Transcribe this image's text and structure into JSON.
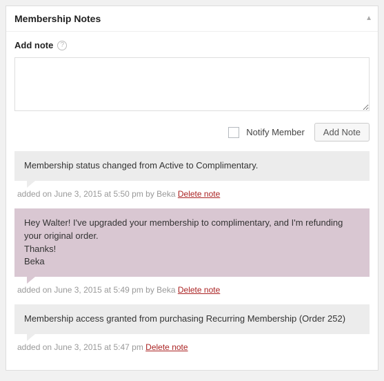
{
  "panel": {
    "title": "Membership Notes"
  },
  "add_note": {
    "label": "Add note",
    "textarea_value": "",
    "notify_label": "Notify Member",
    "notify_checked": false,
    "button_label": "Add Note"
  },
  "notes": [
    {
      "type": "system",
      "content": "Membership status changed from Active to Complimentary.",
      "meta_prefix": "added on ",
      "date": "June 3, 2015 at 5:50 pm",
      "by_word": " by ",
      "author": "Beka",
      "delete_label": "Delete note"
    },
    {
      "type": "customer",
      "content": "Hey Walter! I've upgraded your membership to complimentary, and I'm refunding your original order.\nThanks!\nBeka",
      "meta_prefix": "added on ",
      "date": "June 3, 2015 at 5:49 pm",
      "by_word": " by ",
      "author": "Beka",
      "delete_label": "Delete note"
    },
    {
      "type": "system",
      "content": "Membership access granted from purchasing Recurring Membership (Order 252)",
      "meta_prefix": "added on ",
      "date": "June 3, 2015 at 5:47 pm",
      "by_word": "",
      "author": "",
      "delete_label": "Delete note"
    }
  ]
}
